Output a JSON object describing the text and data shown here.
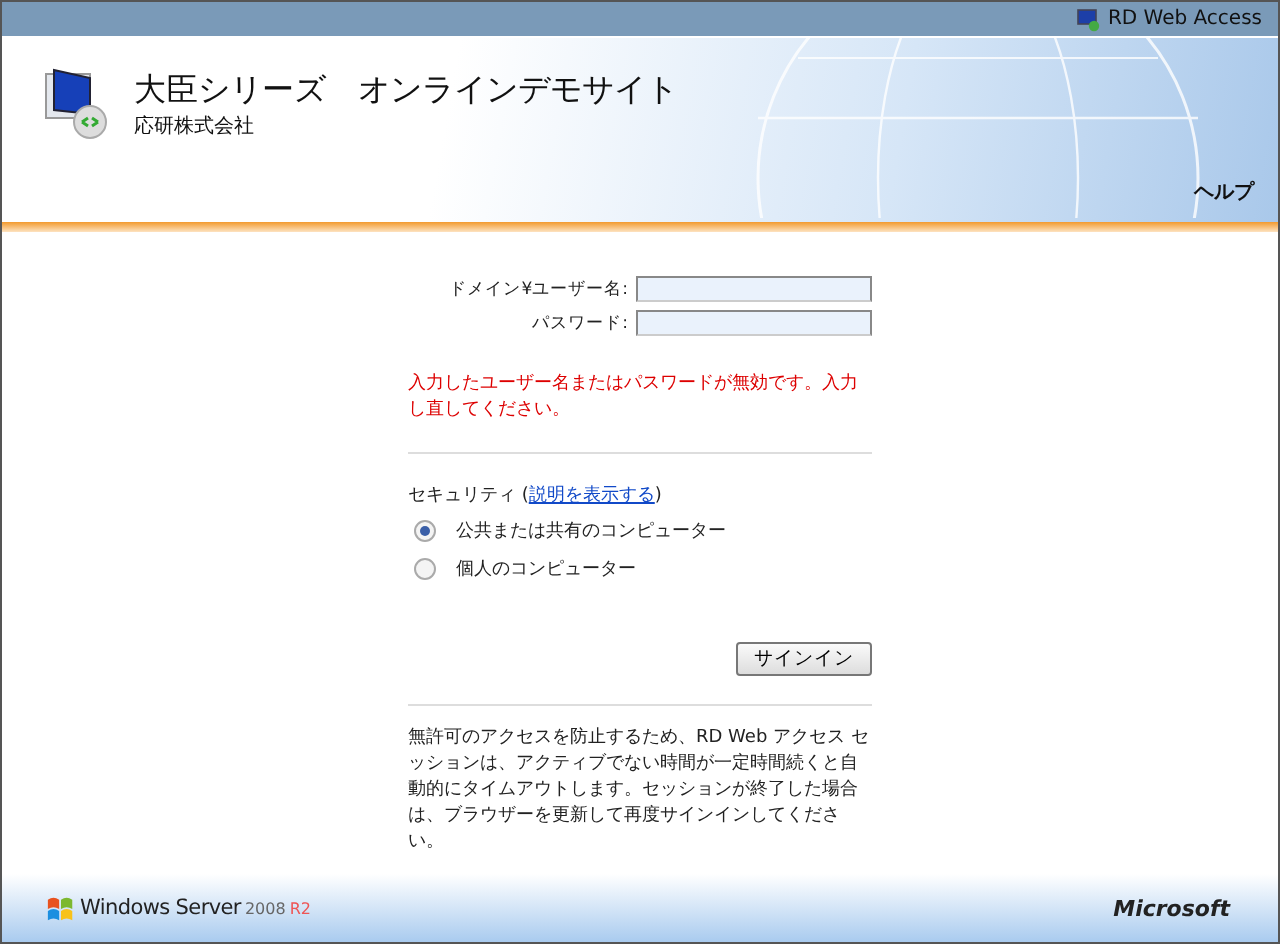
{
  "top_bar": {
    "label": "RD Web Access"
  },
  "header": {
    "title": "大臣シリーズ　オンラインデモサイト",
    "subtitle": "応研株式会社",
    "help": "ヘルプ"
  },
  "form": {
    "fields": [
      {
        "label": "ドメイン¥ユーザー名:"
      },
      {
        "label": "パスワード:"
      }
    ],
    "error": "入力したユーザー名またはパスワードが無効です。入力し直してください。",
    "security_label": "セキュリティ (",
    "security_link": "説明を表示する",
    "security_close": ")",
    "options": [
      {
        "label": "公共または共有のコンピューター",
        "selected": true
      },
      {
        "label": "個人のコンピューター",
        "selected": false
      }
    ],
    "sign_in": "サインイン",
    "notice": "無許可のアクセスを防止するため、RD Web アクセス セッションは、アクティブでない時間が一定時間続くと自動的にタイムアウトします。セッションが終了した場合は、ブラウザーを更新して再度サインインしてください。"
  },
  "footer": {
    "product": "Windows Server",
    "version": "2008",
    "edition": "R2",
    "vendor": "Microsoft"
  }
}
